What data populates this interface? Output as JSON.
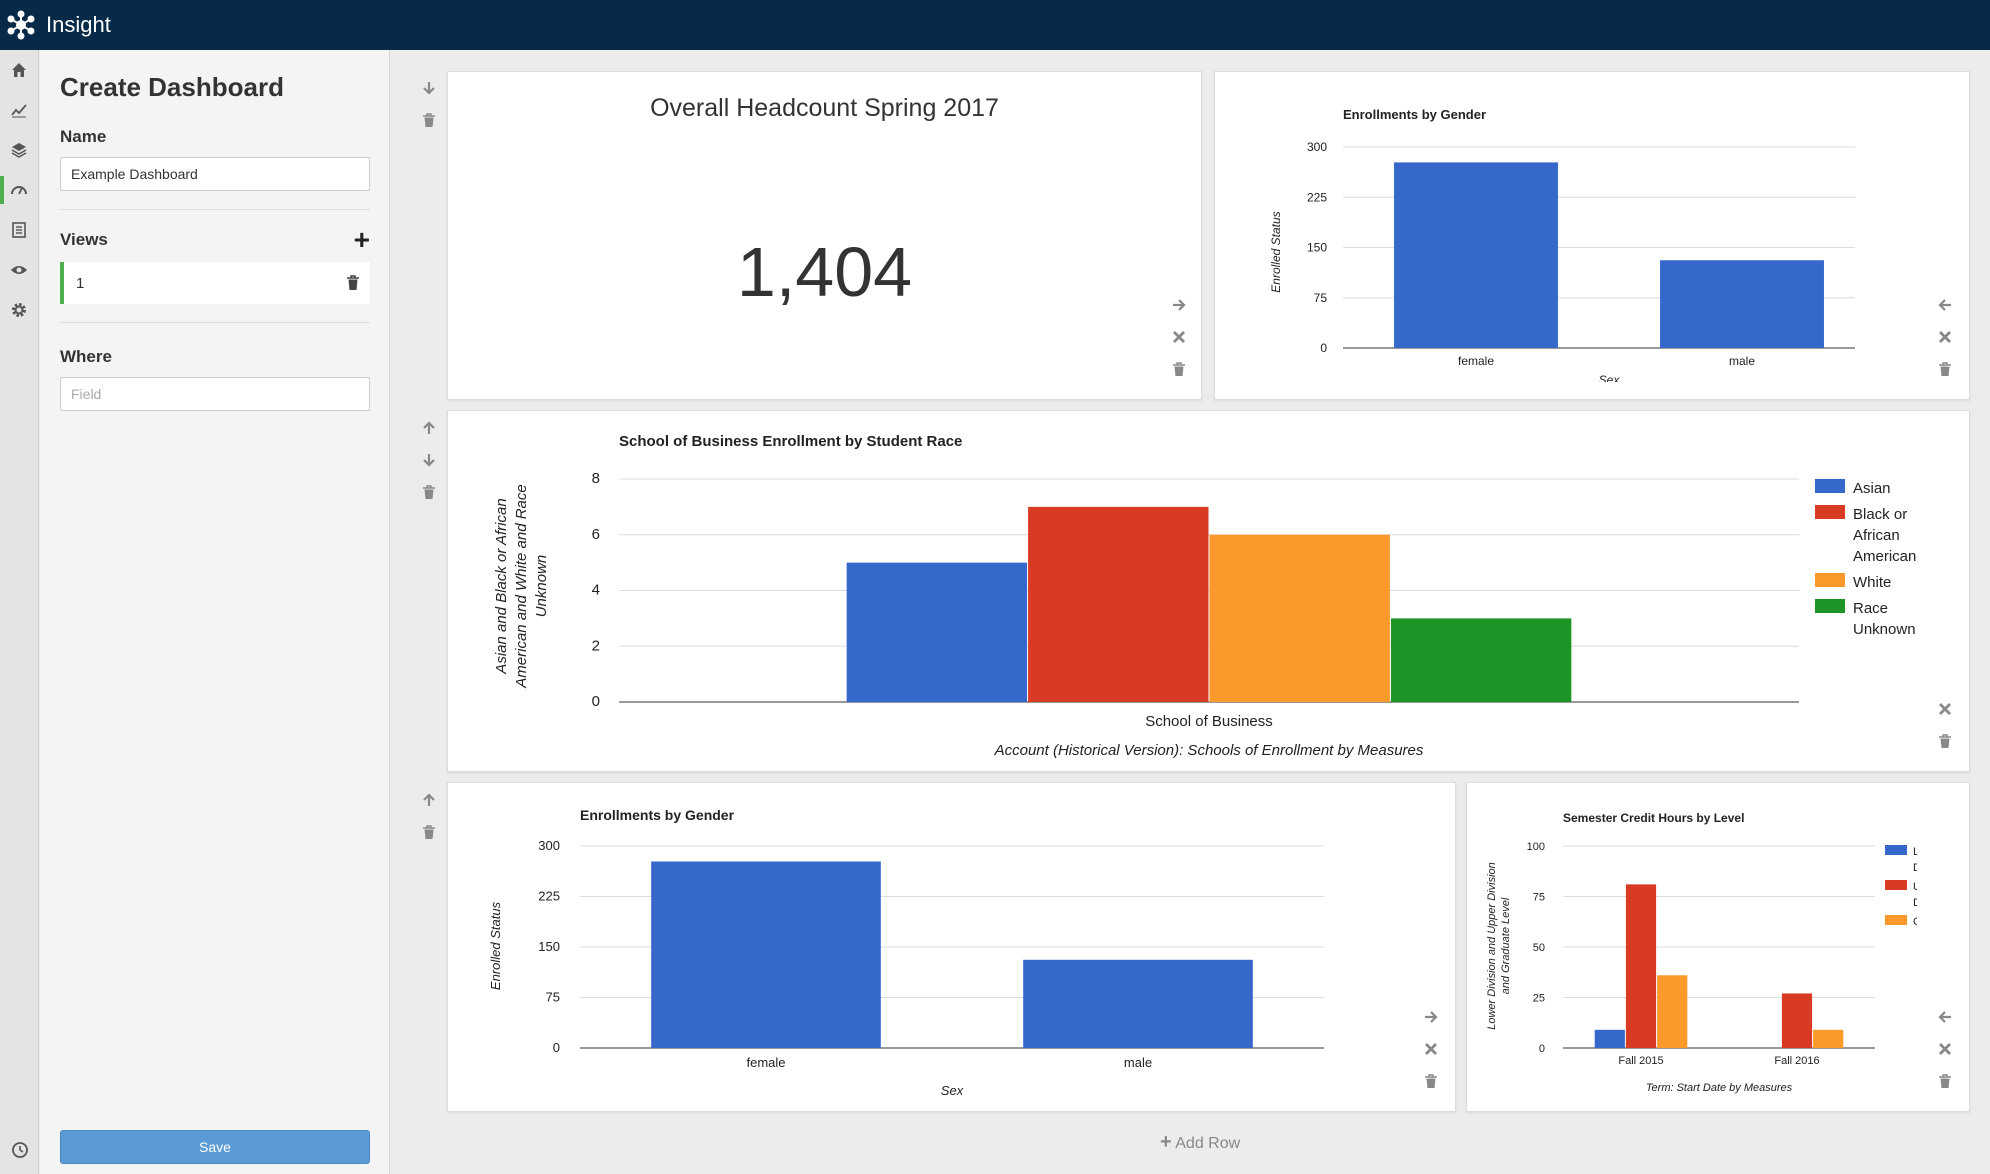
{
  "app": {
    "name": "Insight"
  },
  "rail": [
    "home-icon",
    "trend-icon",
    "layers-icon",
    "dashboard-icon",
    "report-icon",
    "eye-icon",
    "gear-icon"
  ],
  "sidebar": {
    "title": "Create Dashboard",
    "name_label": "Name",
    "name_value": "Example Dashboard",
    "views_label": "Views",
    "views": [
      {
        "label": "1"
      }
    ],
    "where_label": "Where",
    "where_placeholder": "Field",
    "save_label": "Save"
  },
  "dashboard": {
    "headcount": {
      "title": "Overall Headcount Spring 2017",
      "value": "1,404"
    },
    "add_row_label": "Add Row"
  },
  "colors": {
    "blue": "#3668cc",
    "red": "#d93a24",
    "orange": "#fb9a2b",
    "green": "#1e9426"
  },
  "chart_data": [
    {
      "type": "bar",
      "title": "Enrollments by Gender",
      "categories": [
        "female",
        "male"
      ],
      "values": [
        277,
        131
      ],
      "xlabel": "Sex",
      "ylabel": "Enrolled Status",
      "ylim": [
        0,
        300
      ],
      "yticks": [
        "300",
        "225",
        "150",
        "75",
        "0"
      ],
      "grid": true
    },
    {
      "type": "bar",
      "title": "School of Business Enrollment by Student Race",
      "categories": [
        "School of Business"
      ],
      "series": [
        {
          "name": "Asian",
          "values": [
            5
          ]
        },
        {
          "name": "Black or African American",
          "values": [
            7
          ]
        },
        {
          "name": "White",
          "values": [
            6
          ]
        },
        {
          "name": "Race Unknown",
          "values": [
            3
          ]
        }
      ],
      "xlabel": "Account (Historical Version): Schools of Enrollment by Measures",
      "ylabel": "Asian and Black or African American and White and Race Unknown",
      "ylim": [
        0,
        8
      ],
      "yticks": [
        "8",
        "6",
        "4",
        "2",
        "0"
      ],
      "grid": true,
      "legend": "right"
    },
    {
      "type": "bar",
      "title": "Enrollments by Gender",
      "categories": [
        "female",
        "male"
      ],
      "values": [
        277,
        131
      ],
      "xlabel": "Sex",
      "ylabel": "Enrolled Status",
      "ylim": [
        0,
        300
      ],
      "yticks": [
        "300",
        "225",
        "150",
        "75",
        "0"
      ],
      "grid": true
    },
    {
      "type": "bar",
      "title": "Semester Credit Hours by Level",
      "categories": [
        "Fall 2015",
        "Fall 2016"
      ],
      "series": [
        {
          "name": "Lower Division",
          "values": [
            9,
            0
          ]
        },
        {
          "name": "Upper Division",
          "values": [
            81,
            27
          ]
        },
        {
          "name": "Grad...",
          "values": [
            36,
            9
          ]
        }
      ],
      "xlabel": "Term: Start Date by Measures",
      "ylabel": "Lower Division and Upper Division and Graduate Level",
      "ylim": [
        0,
        100
      ],
      "yticks": [
        "100",
        "75",
        "50",
        "25",
        "0"
      ],
      "grid": true,
      "legend": "right"
    }
  ]
}
